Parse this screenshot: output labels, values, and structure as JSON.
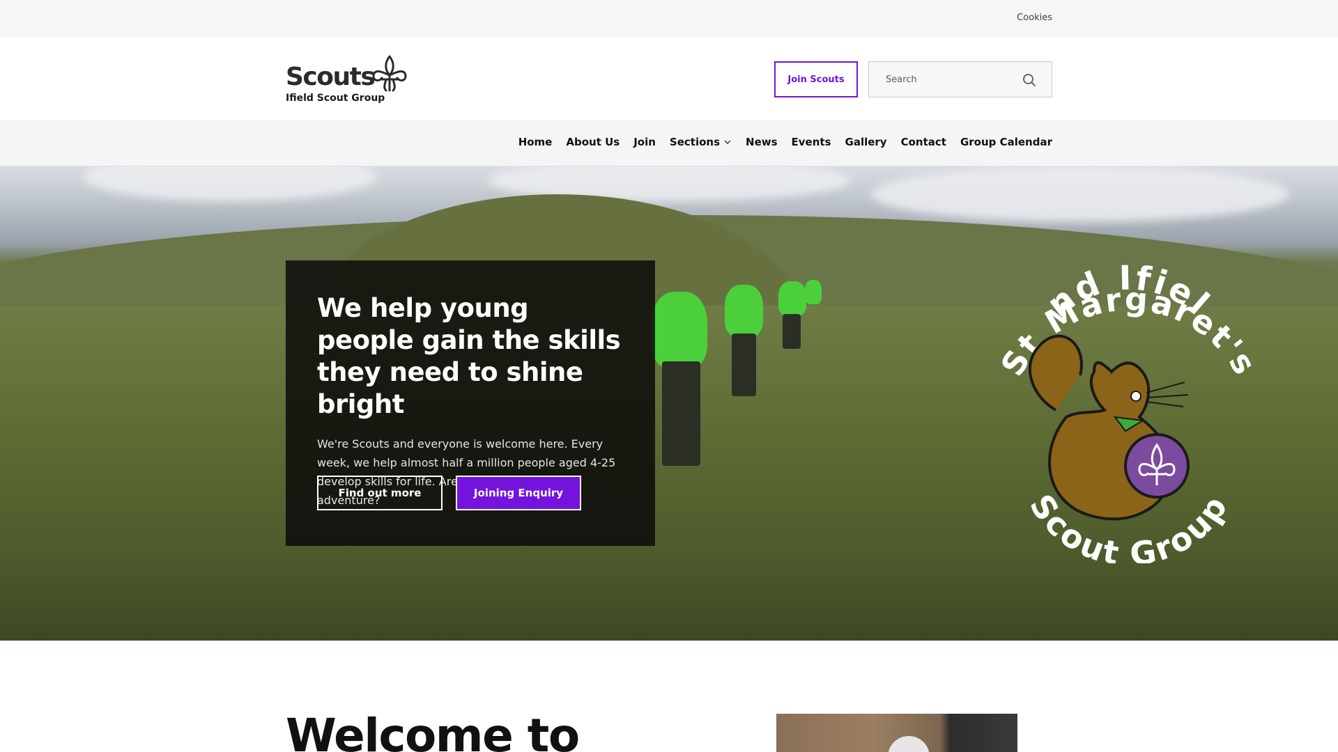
{
  "utility_bar": {
    "cookies_label": "Cookies"
  },
  "header": {
    "logo_wordmark": "Scouts",
    "group_name": "Ifield Scout Group",
    "join_button": "Join Scouts",
    "search_placeholder": "Search"
  },
  "nav": {
    "items": [
      {
        "label": "Home"
      },
      {
        "label": "About Us"
      },
      {
        "label": "Join"
      },
      {
        "label": "Sections",
        "has_dropdown": true
      },
      {
        "label": "News"
      },
      {
        "label": "Events"
      },
      {
        "label": "Gallery"
      },
      {
        "label": "Contact"
      },
      {
        "label": "Group Calendar"
      }
    ]
  },
  "hero": {
    "heading": "We help young people gain the skills they need to shine bright",
    "body": "We're Scouts and everyone is welcome here. Every week, we help almost half a million people aged 4-25 develop skills for life. Are you ready to join the adventure?",
    "buttons": {
      "secondary": "Find out more",
      "primary": "Joining Enquiry"
    },
    "badge": {
      "top_text": "2nd Ifield",
      "middle_text": "St Margaret's",
      "bottom_text": "Scout Group"
    }
  },
  "welcome": {
    "heading": "Welcome to"
  },
  "colors": {
    "brand_purple": "#7413dc",
    "panel": "#0a0a0a",
    "nav_bg": "#f5f5f5"
  },
  "icons": {
    "search": "search-icon",
    "logo": "fleur-de-lis-icon",
    "dropdown": "chevron-down-icon"
  }
}
